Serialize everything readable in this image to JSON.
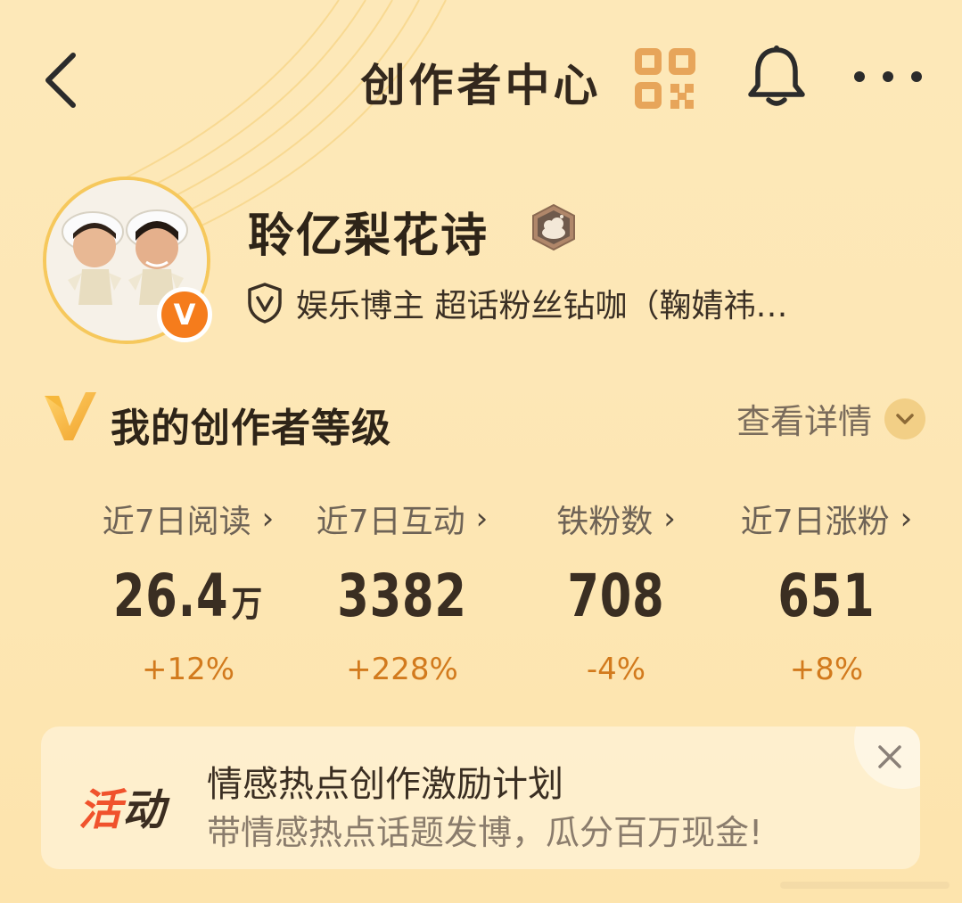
{
  "header": {
    "title": "创作者中心",
    "back_icon": "chevron-left-icon",
    "qr_icon": "qr-code-icon",
    "bell_icon": "bell-icon",
    "more_icon": "more-horizontal-icon"
  },
  "profile": {
    "name": "聆亿梨花诗",
    "verified_mark": "V",
    "identity": "娱乐博主 超话粉丝钻咖（鞠婧祎…",
    "accent_color": "#f57c1c"
  },
  "level": {
    "title": "我的创作者等级",
    "detail_label": "查看详情"
  },
  "stats": [
    {
      "label": "近7日阅读",
      "value": "26.4",
      "unit": "万",
      "change": "+12%"
    },
    {
      "label": "近7日互动",
      "value": "3382",
      "unit": "",
      "change": "+228%"
    },
    {
      "label": "铁粉数",
      "value": "708",
      "unit": "",
      "change": "-4%"
    },
    {
      "label": "近7日涨粉",
      "value": "651",
      "unit": "",
      "change": "+8%"
    }
  ],
  "stat_arrow": "›",
  "activity": {
    "tag_part1": "活",
    "tag_part2": "动",
    "title": "情感热点创作激励计划",
    "subtitle": "带情感热点话题发博，瓜分百万现金!",
    "close_icon": "close-icon"
  }
}
